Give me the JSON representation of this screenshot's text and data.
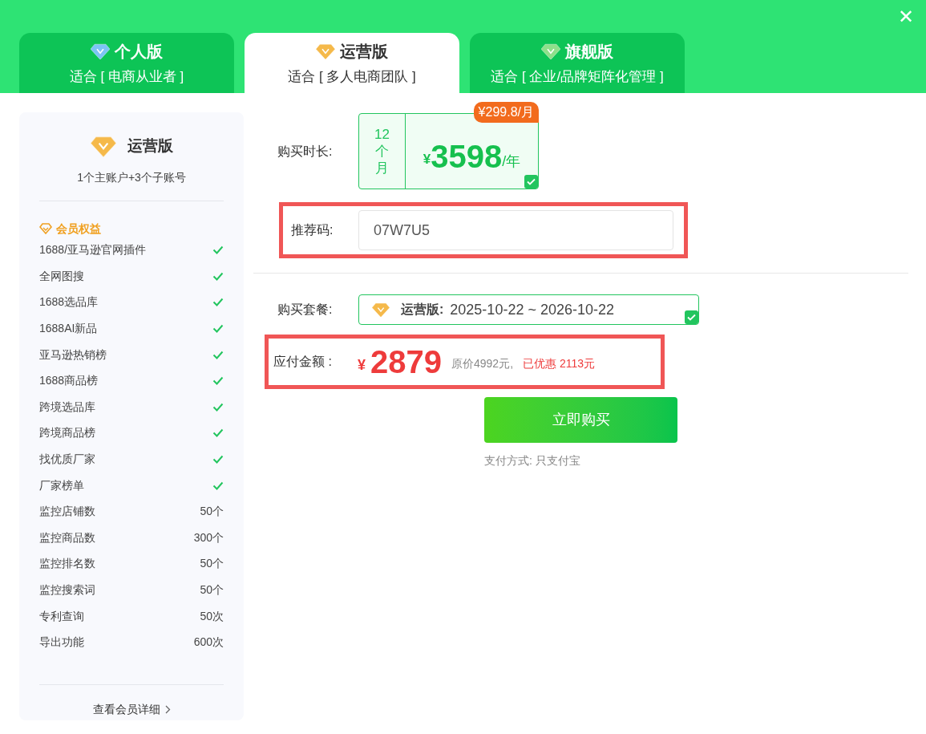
{
  "close_label": "✕",
  "tabs": [
    {
      "name": "个人版",
      "subtitle": "适合 [ 电商从业者 ]",
      "color": "#7cc4f5",
      "selected": false
    },
    {
      "name": "运营版",
      "subtitle": "适合 [ 多人电商团队 ]",
      "color": "#f5b94a",
      "selected": true
    },
    {
      "name": "旗舰版",
      "subtitle": "适合 [ 企业/品牌矩阵化管理 ]",
      "color": "#8ee08a",
      "selected": false
    }
  ],
  "sidebar": {
    "plan_name": "运营版",
    "accounts": "1个主账户+3个子账号",
    "benefits_title": "会员权益",
    "benefits": [
      {
        "name": "1688/亚马逊官网插件",
        "kind": "check"
      },
      {
        "name": "全网图搜",
        "kind": "check"
      },
      {
        "name": "1688选品库",
        "kind": "check"
      },
      {
        "name": "1688AI新品",
        "kind": "check"
      },
      {
        "name": "亚马逊热销榜",
        "kind": "check"
      },
      {
        "name": "1688商品榜",
        "kind": "check"
      },
      {
        "name": "跨境选品库",
        "kind": "check"
      },
      {
        "name": "跨境商品榜",
        "kind": "check"
      },
      {
        "name": "找优质厂家",
        "kind": "check"
      },
      {
        "name": "厂家榜单",
        "kind": "check"
      },
      {
        "name": "监控店铺数",
        "kind": "quota",
        "value": "50个"
      },
      {
        "name": "监控商品数",
        "kind": "quota",
        "value": "300个"
      },
      {
        "name": "监控排名数",
        "kind": "quota",
        "value": "50个"
      },
      {
        "name": "监控搜索词",
        "kind": "quota",
        "value": "50个"
      },
      {
        "name": "专利查询",
        "kind": "quota",
        "value": "50次"
      },
      {
        "name": "导出功能",
        "kind": "quota",
        "value": "600次"
      }
    ],
    "details_link": "查看会员详细"
  },
  "duration": {
    "label": "购买时长:",
    "options": [
      {
        "months": "12",
        "unit_1": "个",
        "unit_2": "月",
        "currency": "¥",
        "price": "3598",
        "per": "/年",
        "badge": "¥299.8/月",
        "selected": true
      }
    ]
  },
  "referral": {
    "label": "推荐码:",
    "value": "07W7U5",
    "highlighted": true
  },
  "package": {
    "label": "购买套餐:",
    "plan": "运营版:",
    "period": "2025-10-22 ~ 2026-10-22",
    "selected": true
  },
  "amount": {
    "label": "应付金额 :",
    "currency": "¥",
    "value": "2879",
    "original": "原价4992元,",
    "discount": "已优惠 2113元",
    "highlighted": true
  },
  "buy_button": "立即购买",
  "payment_note": "支付方式: 只支付宝"
}
